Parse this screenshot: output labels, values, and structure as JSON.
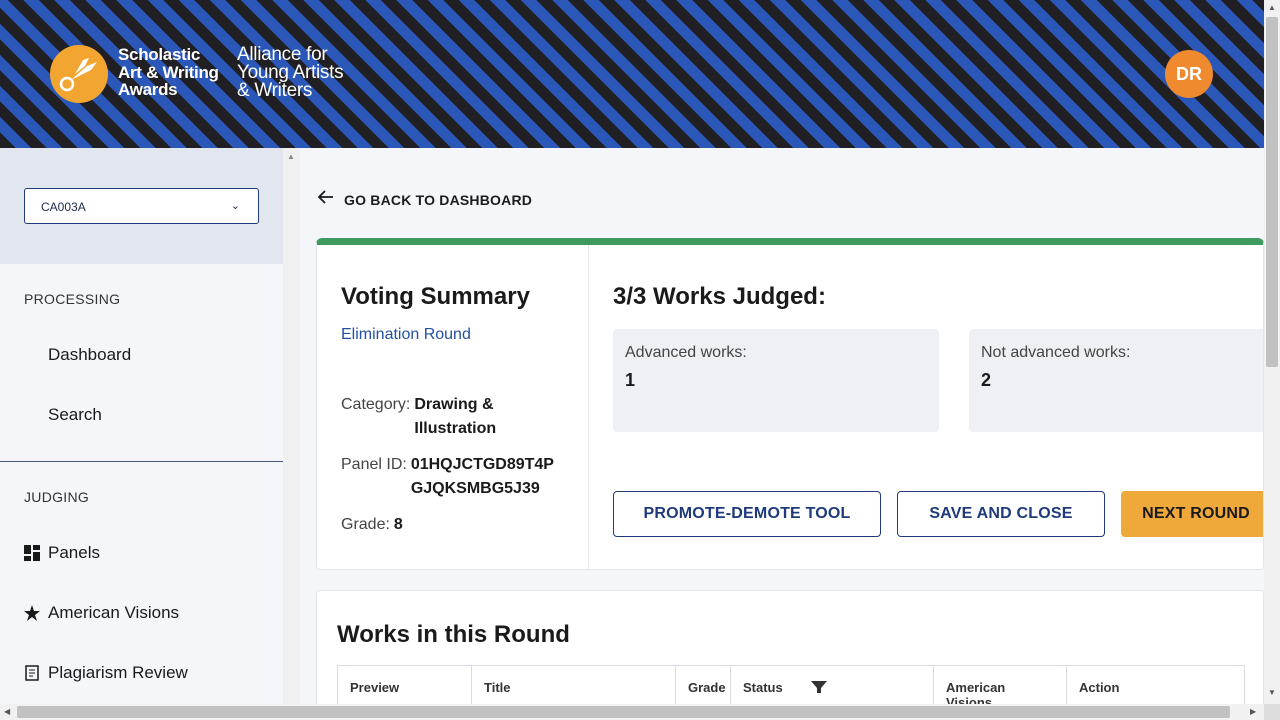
{
  "header": {
    "brand_line1": "Scholastic",
    "brand_line2": "Art & Writing",
    "brand_line3": "Awards",
    "sub_line1": "Alliance for",
    "sub_line2": "Young Artists",
    "sub_line3": "& Writers",
    "avatar_initials": "DR",
    "colors": {
      "stripe_dark": "#1f1f24",
      "stripe_blue": "#2a57b8",
      "logo": "#f2a531",
      "avatar": "#ef8a2f"
    }
  },
  "sidebar": {
    "selected_panel": "CA003A",
    "processing_label": "PROCESSING",
    "processing_items": [
      {
        "label": "Dashboard"
      },
      {
        "label": "Search"
      }
    ],
    "judging_label": "JUDGING",
    "judging_items": [
      {
        "label": "Panels",
        "icon": "grid-icon"
      },
      {
        "label": "American Visions",
        "icon": "star-icon"
      },
      {
        "label": "Plagiarism Review",
        "icon": "document-icon"
      }
    ]
  },
  "main": {
    "back_label": "GO BACK TO DASHBOARD",
    "summary": {
      "title": "Voting Summary",
      "round": "Elimination Round",
      "category_label": "Category:",
      "category_value_1": "Drawing &",
      "category_value_2": "Illustration",
      "panel_label": "Panel ID:",
      "panel_value_1": "01HQJCTGD89T4P",
      "panel_value_2": "GJQKSMBG5J39",
      "grade_label": "Grade:",
      "grade_value": "8"
    },
    "judged": {
      "title": "3/3 Works Judged:",
      "advanced_label": "Advanced works:",
      "advanced_value": "1",
      "not_advanced_label": "Not advanced works:",
      "not_advanced_value": "2"
    },
    "buttons": {
      "promote": "PROMOTE-DEMOTE TOOL",
      "save": "SAVE AND CLOSE",
      "next": "NEXT ROUND"
    },
    "works": {
      "title": "Works in this Round",
      "columns": [
        "Preview",
        "Title",
        "Grade",
        "Status",
        "American Visions",
        "Action"
      ]
    }
  }
}
